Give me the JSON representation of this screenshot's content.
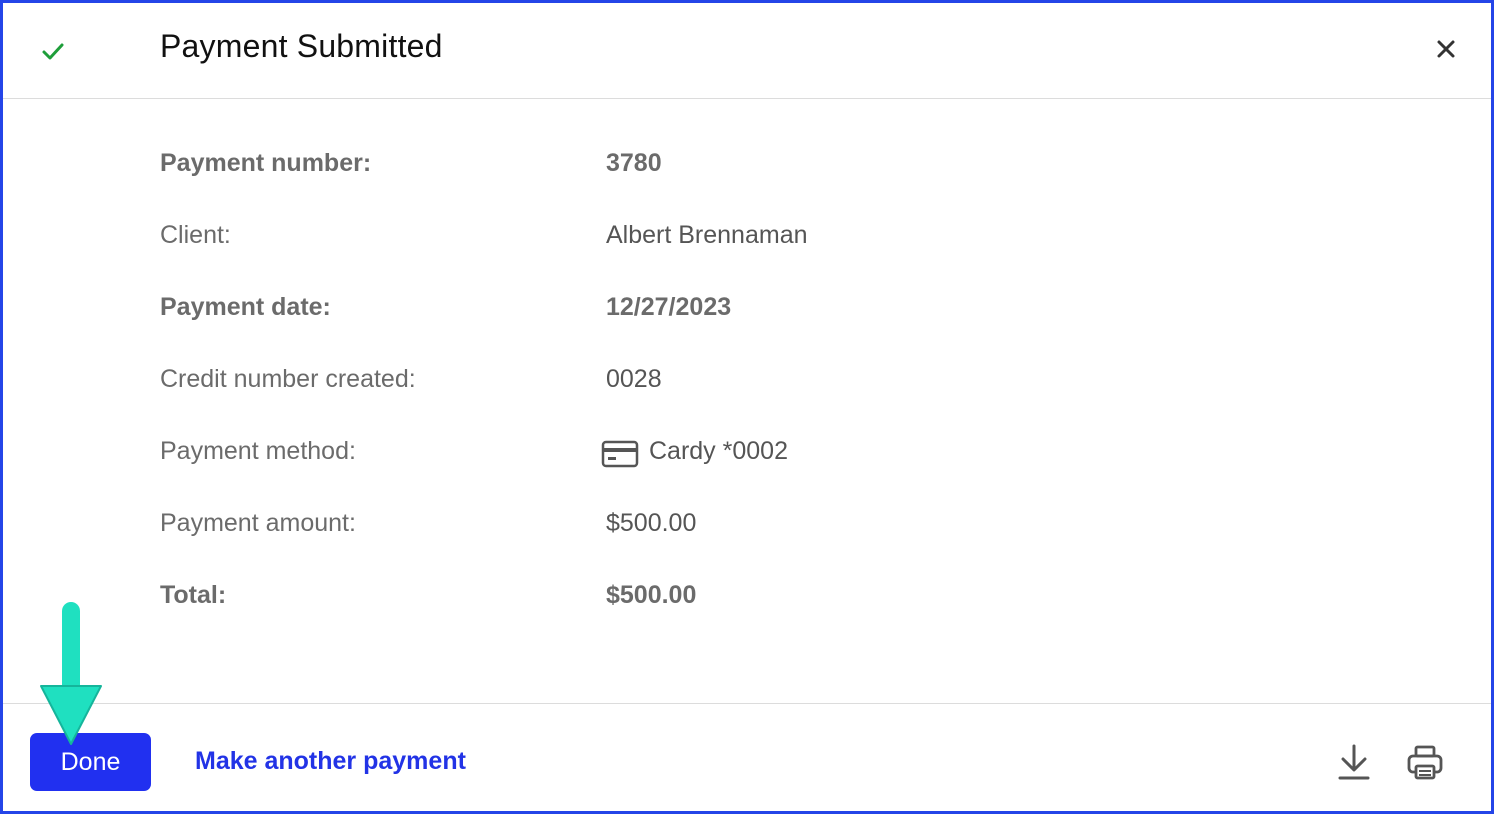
{
  "header": {
    "title": "Payment Submitted",
    "status_icon": "check-icon",
    "close_icon": "close-icon"
  },
  "details": [
    {
      "label": "Payment number:",
      "value": "3780",
      "bold": true
    },
    {
      "label": "Client:",
      "value": "Albert Brennaman",
      "bold": false
    },
    {
      "label": "Payment date:",
      "value": "12/27/2023",
      "bold": true
    },
    {
      "label": "Credit number created:",
      "value": "0028",
      "bold": false
    },
    {
      "label": "Payment method:",
      "value": "Cardy *0002",
      "bold": false,
      "icon": "credit-card-icon"
    },
    {
      "label": "Payment amount:",
      "value": "$500.00",
      "bold": false
    },
    {
      "label": "Total:",
      "value": "$500.00",
      "bold": true
    }
  ],
  "footer": {
    "done_label": "Done",
    "another_label": "Make another payment",
    "download_icon": "download-icon",
    "print_icon": "print-icon"
  },
  "colors": {
    "accent": "#2130f0",
    "link": "#2233e6",
    "check": "#1e9e3a",
    "frame_border": "#2445e8",
    "annotation_arrow": "#1fe0c0"
  }
}
